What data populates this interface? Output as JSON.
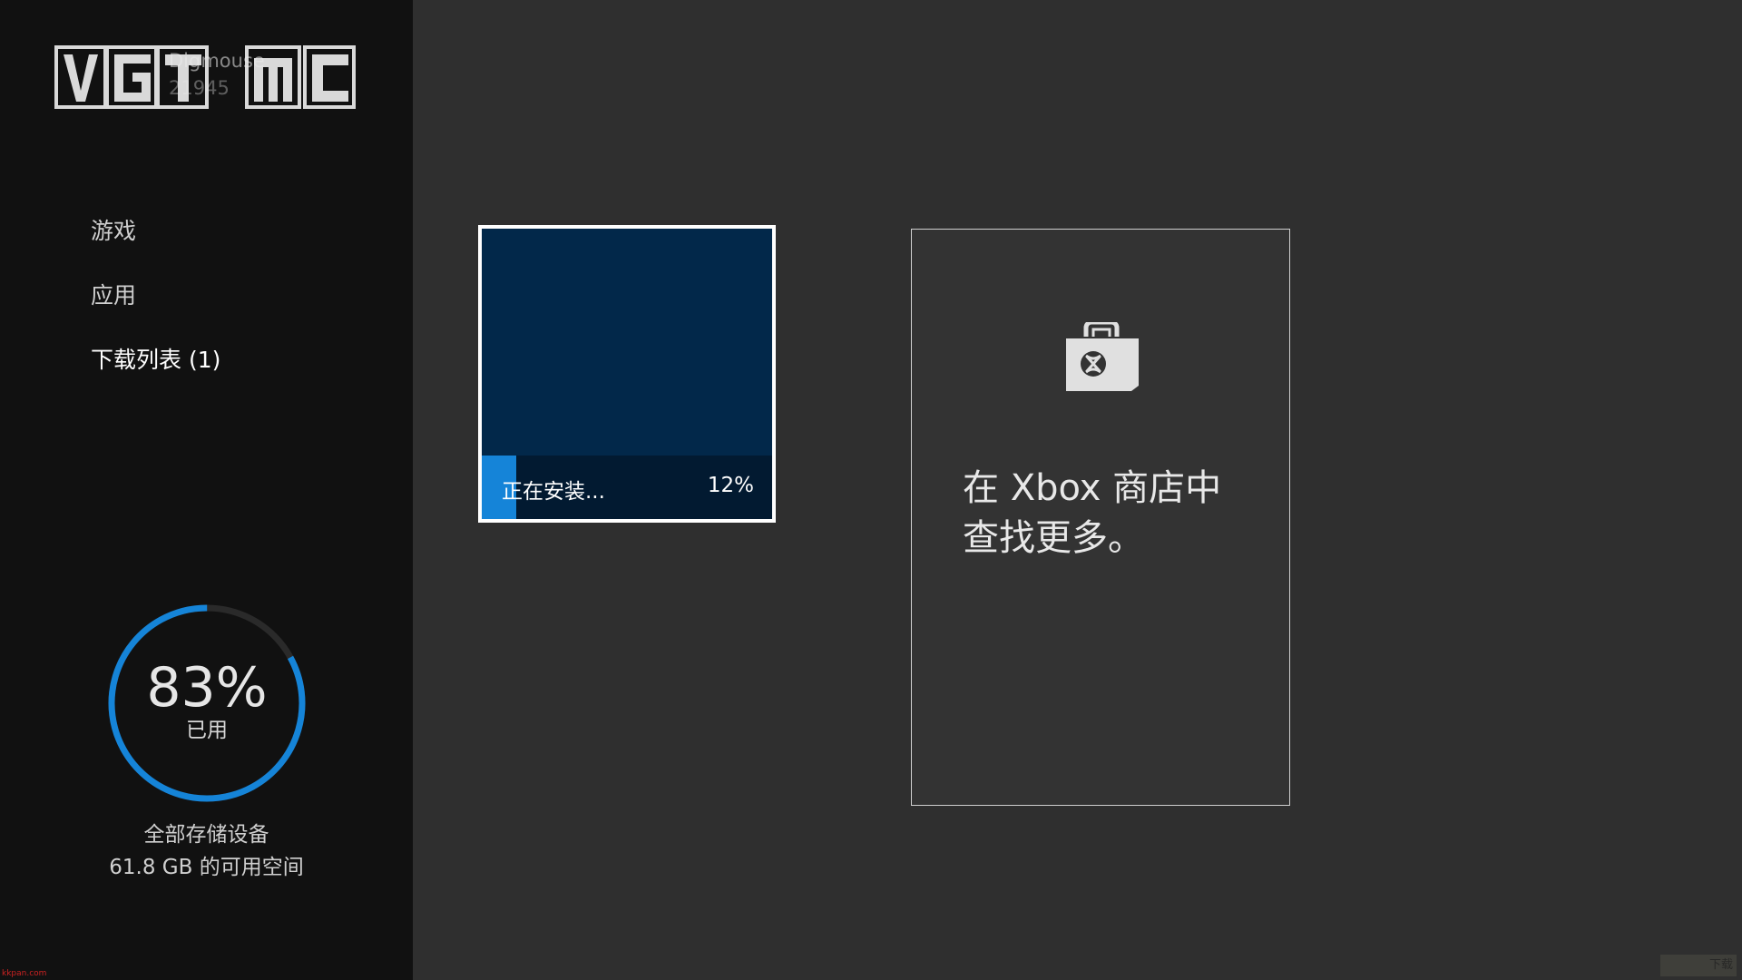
{
  "logo": {
    "text": "VGTIME",
    "description": "VGTime watermark logo"
  },
  "profile": {
    "gamertag": "Digmouse",
    "score": "21945"
  },
  "sidebar": {
    "items": [
      {
        "label": "游戏"
      },
      {
        "label": "应用"
      },
      {
        "label": "下载列表 (1)"
      }
    ]
  },
  "storage": {
    "percent_used": 0.83,
    "percent_label": "83%",
    "used_label": "已用",
    "device_label": "全部存储设备",
    "free_space": "61.8 GB 的可用空间"
  },
  "install_tile": {
    "status": "正在安装...",
    "progress_label": "12%",
    "progress": 0.12
  },
  "store_tile": {
    "icon": "xbox-store-bag-icon",
    "line1": "在 Xbox 商店中",
    "line2": "查找更多。"
  },
  "watermarks": {
    "bottom_left": "kkpan.com",
    "bottom_right": "下载"
  },
  "colors": {
    "accent": "#1584d8",
    "sidebar_bg": "#111111",
    "main_bg": "#2f2f2f",
    "tile_bg": "#02284a"
  }
}
